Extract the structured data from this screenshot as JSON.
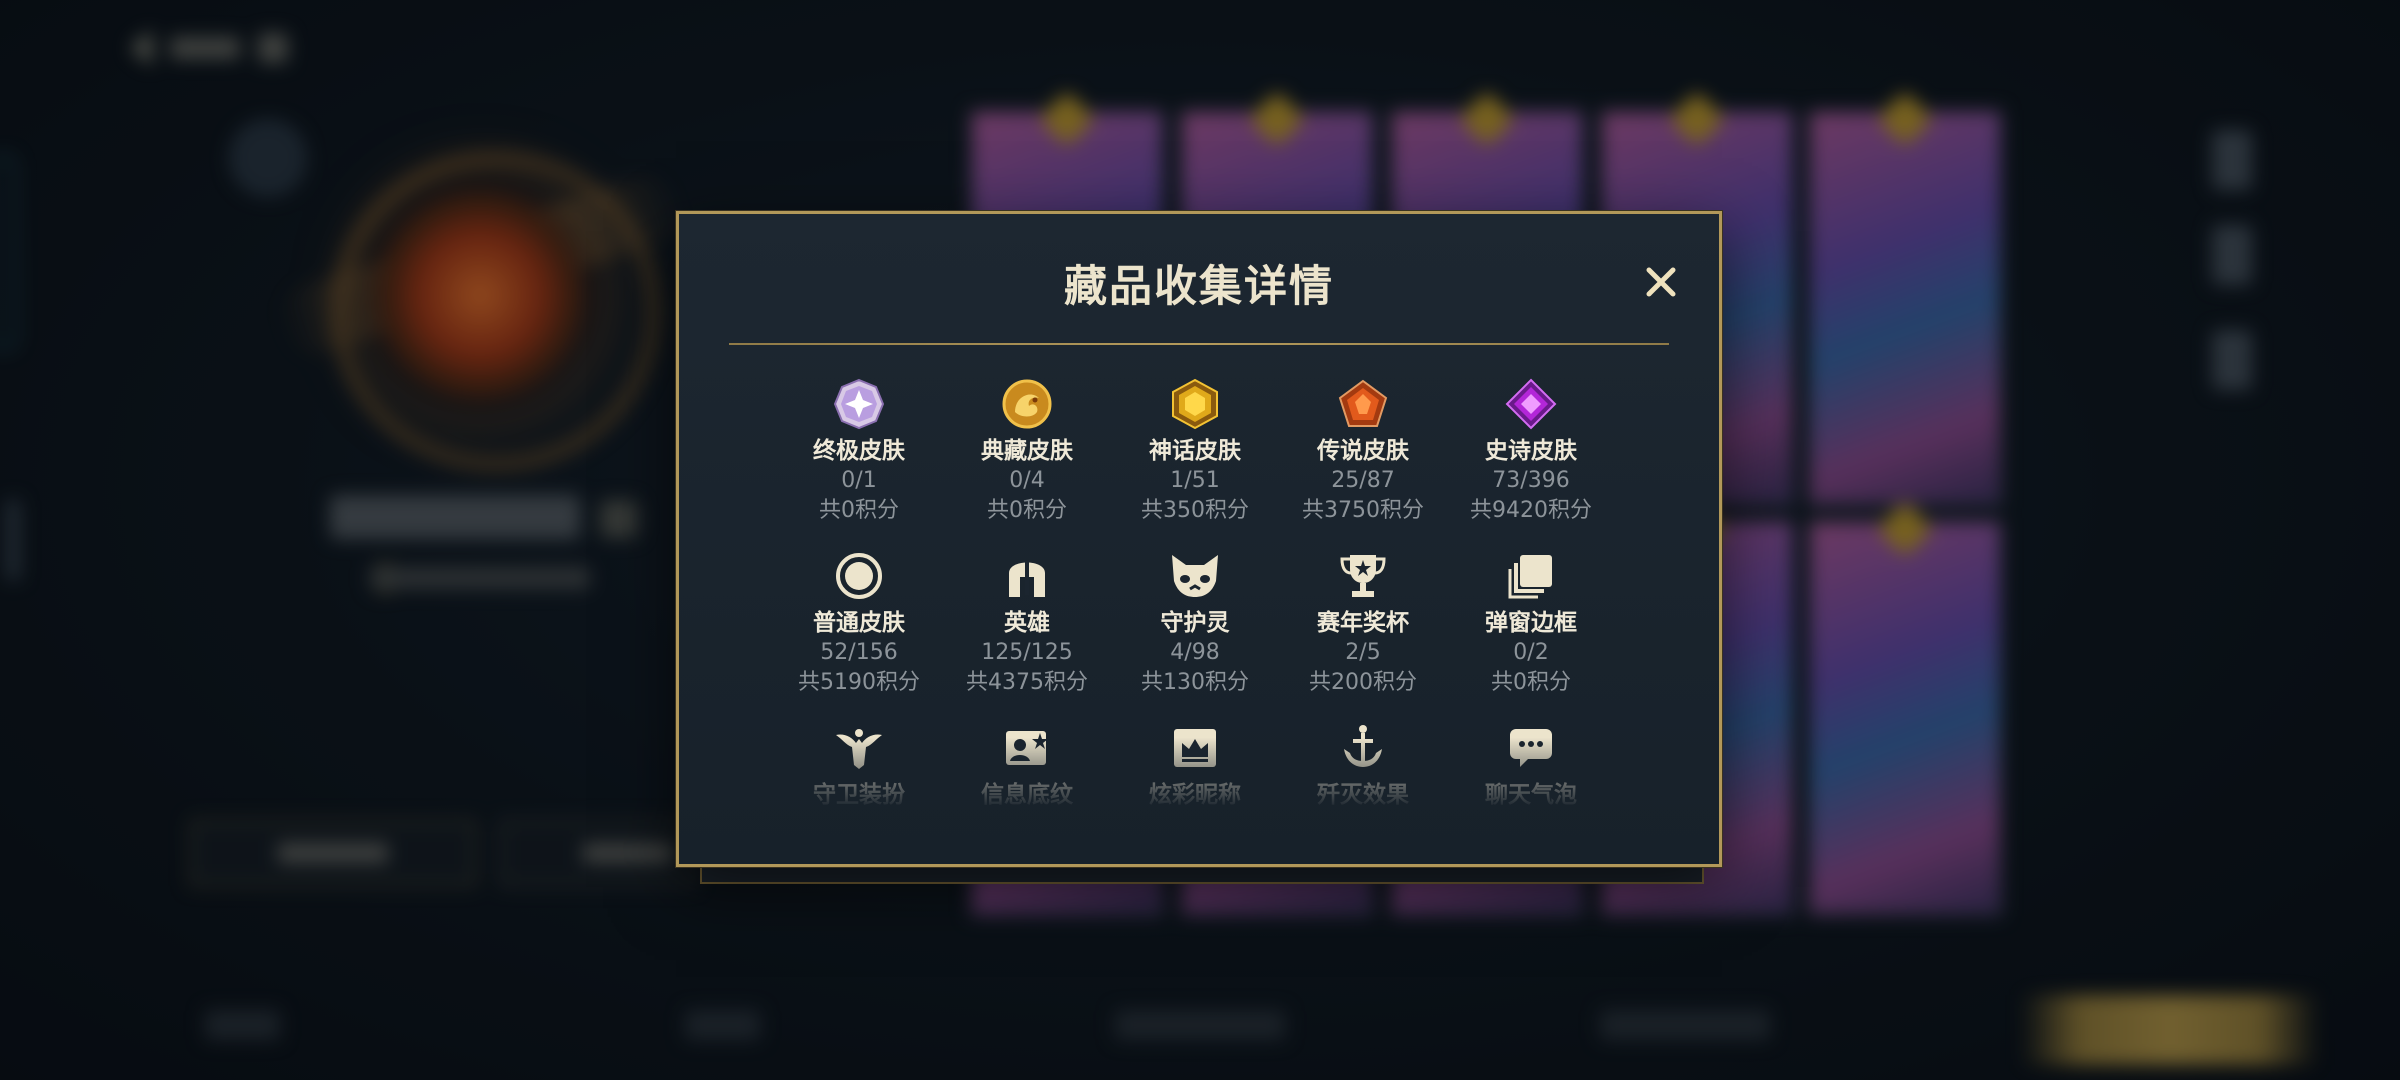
{
  "dialog": {
    "title": "藏品收集详情",
    "close_label": "×"
  },
  "colors": {
    "accent_gold": "#b29859",
    "title_text": "#ece4cc",
    "muted_text": "#8d949a",
    "panel_bg": "#1b252f"
  },
  "categories": [
    {
      "name": "终极皮肤",
      "count": "0/1",
      "points": "共0积分",
      "icon": "ultimate-skin-gem-icon"
    },
    {
      "name": "典藏皮肤",
      "count": "0/4",
      "points": "共0积分",
      "icon": "collection-skin-dragon-icon"
    },
    {
      "name": "神话皮肤",
      "count": "1/51",
      "points": "共350积分",
      "icon": "myth-skin-gem-icon"
    },
    {
      "name": "传说皮肤",
      "count": "25/87",
      "points": "共3750积分",
      "icon": "legend-skin-gem-icon"
    },
    {
      "name": "史诗皮肤",
      "count": "73/396",
      "points": "共9420积分",
      "icon": "epic-skin-gem-icon"
    },
    {
      "name": "普通皮肤",
      "count": "52/156",
      "points": "共5190积分",
      "icon": "normal-skin-circle-icon"
    },
    {
      "name": "英雄",
      "count": "125/125",
      "points": "共4375积分",
      "icon": "hero-helmet-icon"
    },
    {
      "name": "守护灵",
      "count": "4/98",
      "points": "共130积分",
      "icon": "guardian-spirit-icon"
    },
    {
      "name": "赛年奖杯",
      "count": "2/5",
      "points": "共200积分",
      "icon": "season-trophy-icon"
    },
    {
      "name": "弹窗边框",
      "count": "0/2",
      "points": "共0积分",
      "icon": "popup-frame-icon"
    },
    {
      "name": "守卫装扮",
      "count": "",
      "points": "",
      "icon": "guard-costume-icon"
    },
    {
      "name": "信息底纹",
      "count": "",
      "points": "",
      "icon": "info-background-icon"
    },
    {
      "name": "炫彩昵称",
      "count": "",
      "points": "",
      "icon": "colorful-nickname-icon"
    },
    {
      "name": "歼灭效果",
      "count": "",
      "points": "",
      "icon": "annihilation-effect-icon"
    },
    {
      "name": "聊天气泡",
      "count": "",
      "points": "",
      "icon": "chat-bubble-icon"
    }
  ]
}
